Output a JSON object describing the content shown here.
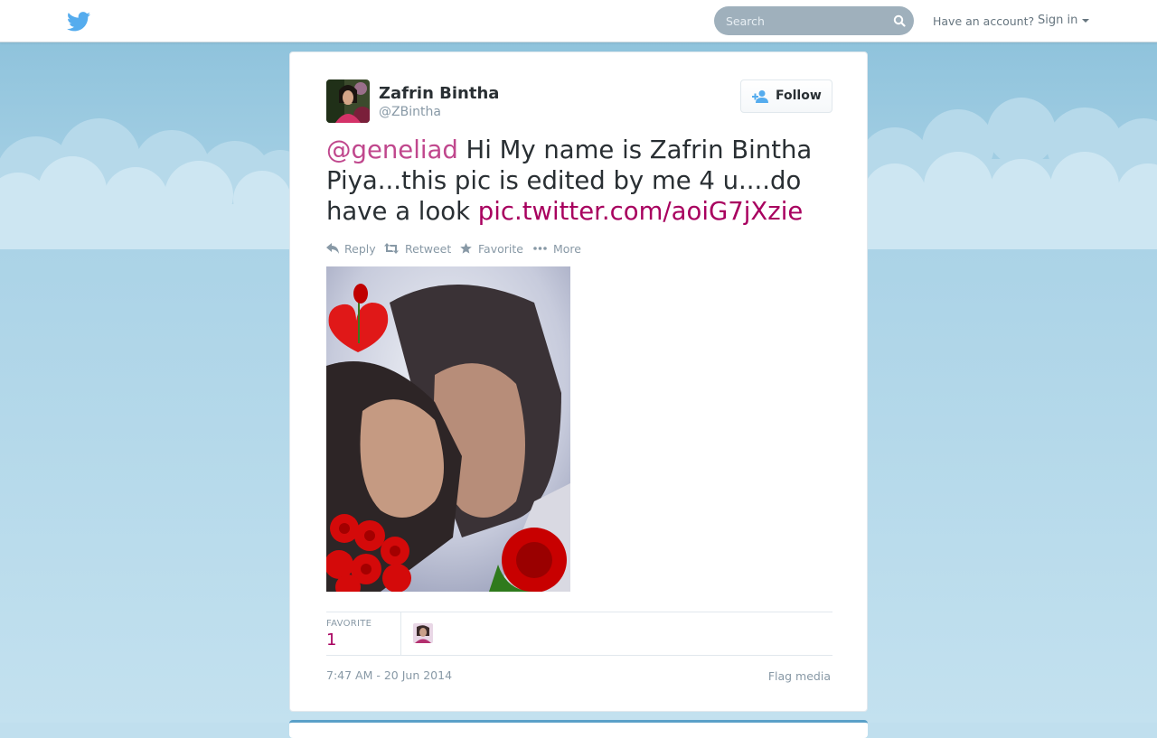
{
  "topbar": {
    "logo_icon": "twitter-bird-icon",
    "search_placeholder": "Search",
    "have_account": "Have an account?",
    "sign_in": "Sign in"
  },
  "tweet": {
    "fullname": "Zafrin Bintha",
    "screenname": "@ZBintha",
    "follow_label": "Follow",
    "text": {
      "mention": "@geneliad",
      "body": " Hi My name is Zafrin Bintha Piya...this pic is edited by me 4 u....do have a look ",
      "link": "pic.twitter.com/aoiG7jXzie"
    },
    "actions": {
      "reply": "Reply",
      "retweet": "Retweet",
      "favorite": "Favorite",
      "more": "More"
    },
    "stats": {
      "favorite_label": "FAVORITE",
      "favorite_count": "1"
    },
    "timestamp": "7:47 AM - 20 Jun 2014",
    "flag_media": "Flag media"
  },
  "colors": {
    "accent": "#a8005f",
    "background": "#c0dfee",
    "twitter_blue": "#55acee"
  }
}
